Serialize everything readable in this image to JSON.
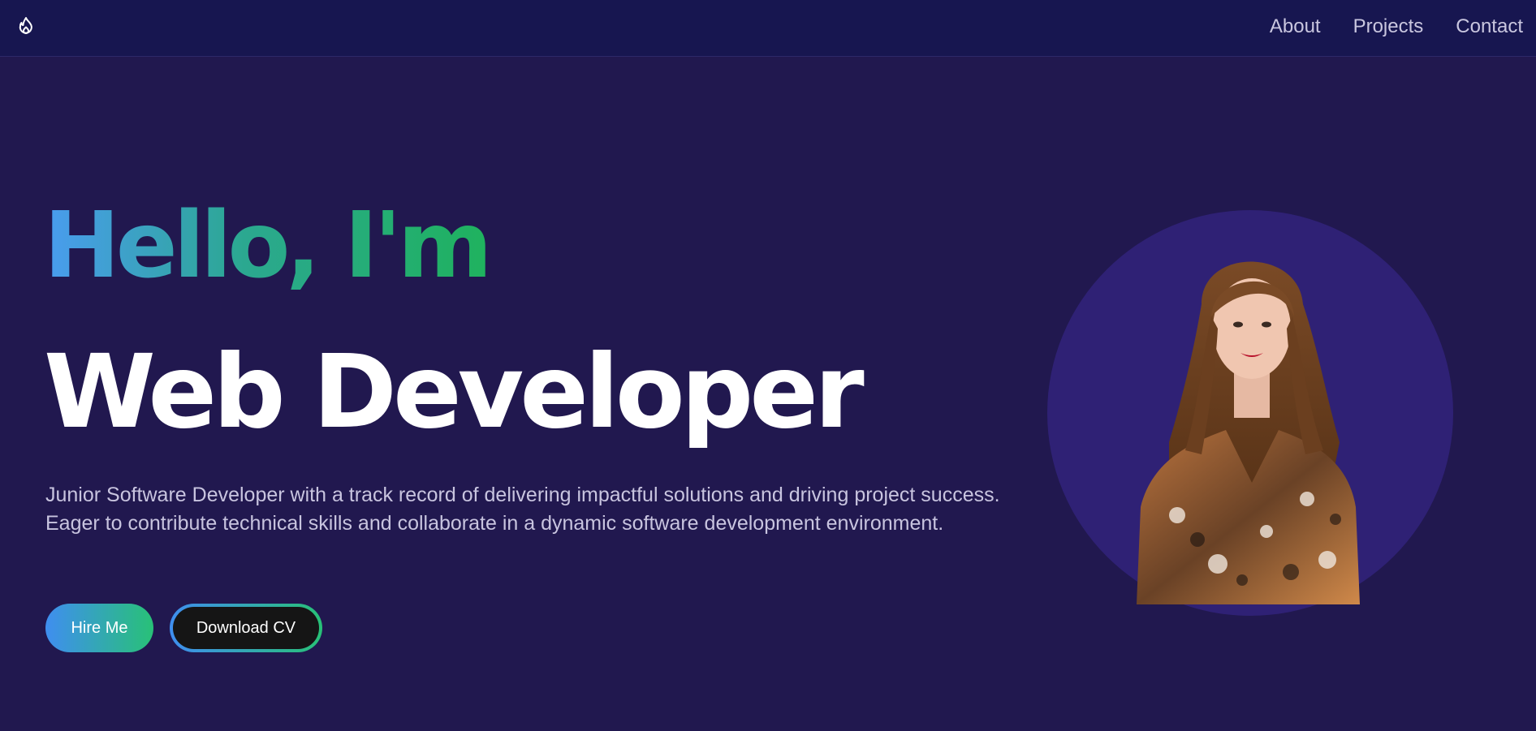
{
  "nav": {
    "logo_icon": "flame-icon",
    "links": [
      "About",
      "Projects",
      "Contact"
    ]
  },
  "hero": {
    "greeting": "Hello, I'm",
    "title": "Web Developer",
    "description": "Junior Software Developer with a track record of delivering impactful solutions and driving project success. Eager to contribute technical skills and collaborate in a dynamic software development environment.",
    "hire_label": "Hire Me",
    "cv_label": "Download CV"
  },
  "colors": {
    "background": "#21184f",
    "navbar": "#171650",
    "gradient_start": "#3f8ef0",
    "gradient_end": "#28c177",
    "portrait_circle": "#2f2175"
  }
}
